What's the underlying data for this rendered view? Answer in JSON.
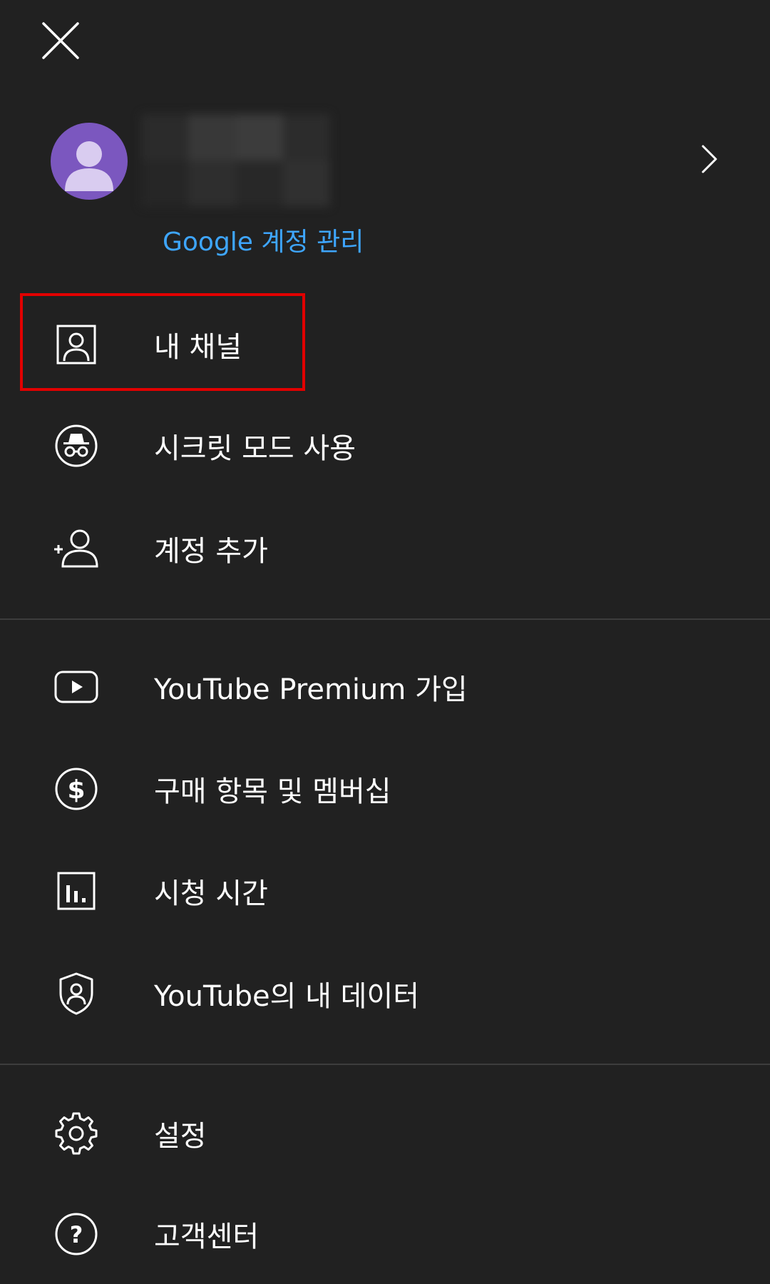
{
  "header": {
    "close_icon": "close-icon"
  },
  "account": {
    "avatar_icon": "person-avatar-icon",
    "avatar_color": "#7b57bf",
    "manage_label": "Google 계정 관리",
    "chevron_icon": "chevron-right-icon",
    "link_color": "#3ea6ff"
  },
  "menu": {
    "group1": [
      {
        "label": "내 채널",
        "icon": "channel-icon"
      },
      {
        "label": "시크릿 모드 사용",
        "icon": "incognito-icon"
      },
      {
        "label": "계정 추가",
        "icon": "add-account-icon"
      }
    ],
    "group2": [
      {
        "label": "YouTube Premium 가입",
        "icon": "youtube-play-icon"
      },
      {
        "label": "구매 항목 및 멤버십",
        "icon": "dollar-icon"
      },
      {
        "label": "시청 시간",
        "icon": "bar-chart-icon"
      },
      {
        "label": "YouTube의 내 데이터",
        "icon": "shield-person-icon"
      }
    ],
    "group3": [
      {
        "label": "설정",
        "icon": "gear-icon"
      },
      {
        "label": "고객센터",
        "icon": "help-icon"
      }
    ]
  },
  "colors": {
    "background": "#212121",
    "divider": "#3d3d3d",
    "highlight": "#e10000"
  }
}
